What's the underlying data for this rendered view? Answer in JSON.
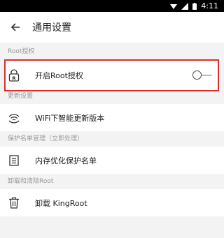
{
  "status_bar": {
    "time": "4:11"
  },
  "toolbar": {
    "title": "通用设置"
  },
  "sections": [
    {
      "header": "Root授权",
      "items": [
        {
          "label": "开启Root授权",
          "icon": "root-lock-icon",
          "toggle_on": false
        }
      ]
    },
    {
      "header": "更新设置",
      "items": [
        {
          "label": "WiFi下智能更新版本",
          "icon": "wifi-icon"
        }
      ]
    },
    {
      "header": "保护名单管理（立即处理）",
      "items": [
        {
          "label": "内存优化保护名单",
          "icon": "list-icon"
        }
      ]
    },
    {
      "header": "卸载和清除Root",
      "items": [
        {
          "label": "卸载 KingRoot",
          "icon": "trash-icon"
        }
      ]
    }
  ],
  "colors": {
    "highlight_border": "#d9302b",
    "background": "#f3f3f3"
  }
}
